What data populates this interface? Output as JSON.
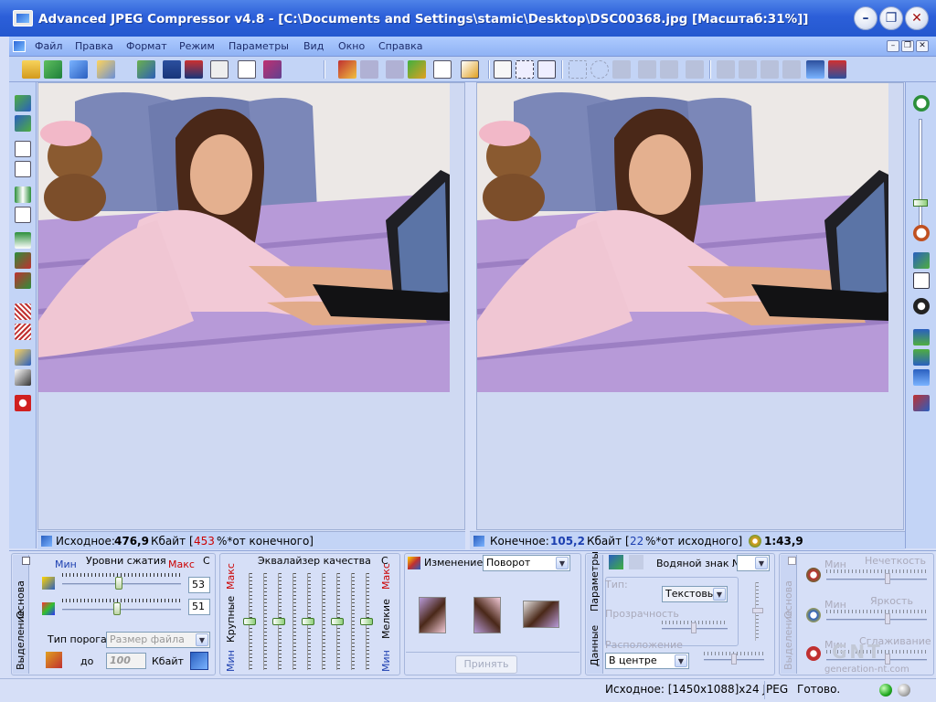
{
  "window": {
    "title": "Advanced JPEG Compressor v4.8 - [C:\\Documents and Settings\\stamic\\Desktop\\DSC00368.jpg  [Масштаб:31%]]",
    "minimize": "–",
    "maximize": "❐",
    "close": "✕"
  },
  "menu": [
    "Файл",
    "Правка",
    "Формат",
    "Режим",
    "Параметры",
    "Вид",
    "Окно",
    "Справка"
  ],
  "panes": {
    "original_status": {
      "prefix": "Исходное:",
      "size": "476,9",
      "unit": "Кбайт",
      "open": "[",
      "percent": "453",
      "suffix": "%*от конечного]"
    },
    "result_status": {
      "prefix": "Конечное:",
      "size": "105,2",
      "unit": "Кбайт",
      "open": "[",
      "percent": "22",
      "suffix": "%*от исходного]"
    },
    "time": "1:43,9"
  },
  "compression": {
    "tab_main": "Основа",
    "tab_select": "Выделение",
    "min": "Мин",
    "title": "Уровни сжатия",
    "max": "Макс",
    "c": "C",
    "level1": "53",
    "level2": "51",
    "level1_frac": 0.48,
    "level2_frac": 0.46,
    "threshold_label": "Тип порога",
    "threshold_value": "Размер файла",
    "to": "до",
    "limit": "100",
    "unit": "Кбайт"
  },
  "equalizer": {
    "title": "Эквалайзер качества",
    "c": "C",
    "max": "Макс",
    "min": "Мин",
    "coarse": "Крупные",
    "fine": "Мелкие"
  },
  "change": {
    "label": "Изменение",
    "value": "Поворот",
    "apply": "Принять"
  },
  "watermark": {
    "tab_params": "Параметры",
    "tab_data": "Данные",
    "label": "Водяной знак №",
    "number": "",
    "type_label": "Тип:",
    "type_value": "Текстовый",
    "transparency": "Прозрачность",
    "position_label": "Расположение",
    "position_value": "В центре"
  },
  "adjust": {
    "tab_main": "Основа",
    "tab_select": "Выделение",
    "min": "Мин",
    "sharpness": "Нечеткость",
    "brightness": "Яркость",
    "smoothing": "Сглаживание"
  },
  "statusbar": {
    "info": "Исходное: [1450x1088]x24 JPEG",
    "state": "Готово."
  },
  "watermark_logo": "GNT",
  "watermark_site": "generation-nt.com",
  "colors": {
    "accent_red": "#cc0000",
    "accent_blue": "#1c3fb0",
    "green": "#22aa22"
  }
}
